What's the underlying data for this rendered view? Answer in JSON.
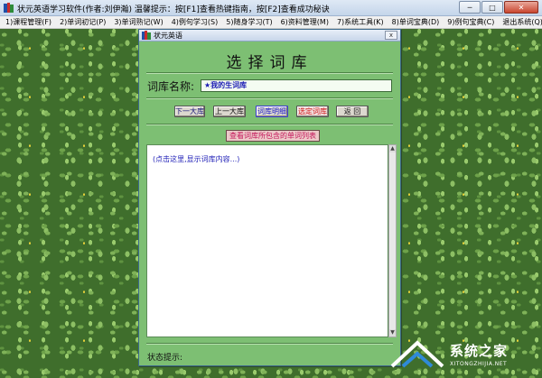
{
  "window": {
    "title": "状元英语学习软件(作者:刘伊瀚)  温馨提示：按[F1]查看热键指南，按[F2]查看成功秘诀",
    "minimize": "─",
    "maximize": "□",
    "close": "✕"
  },
  "menu": [
    "1)课程管理(F)",
    "2)单词初记(P)",
    "3)单词熟记(W)",
    "4)例句学习(S)",
    "5)随身学习(T)",
    "6)资料管理(M)",
    "7)系统工具(K)",
    "8)单词宝典(D)",
    "9)例句宝典(C)",
    "退出系统(Q)"
  ],
  "dialog": {
    "title": "状元英语",
    "close": "x",
    "heading": "选择词库",
    "library_label": "词库名称:",
    "library_value": "★我的生词库",
    "buttons": {
      "next": "下一大库",
      "prev": "上一大库",
      "detail": "词库明细",
      "select": "选定词库",
      "back": "返 回"
    },
    "list_button": "查看词库所包含的单词列表",
    "content_hint": "(点击这里,显示词库内容...)",
    "status_label": "状态提示:"
  },
  "watermark": {
    "text": "系统之家",
    "sub": "XITONGZHIJIA.NET"
  },
  "colors": {
    "dialog_bg": "#7dbf73",
    "select_button_text": "#d01b1b",
    "detail_button_text": "#1d1bc8"
  }
}
